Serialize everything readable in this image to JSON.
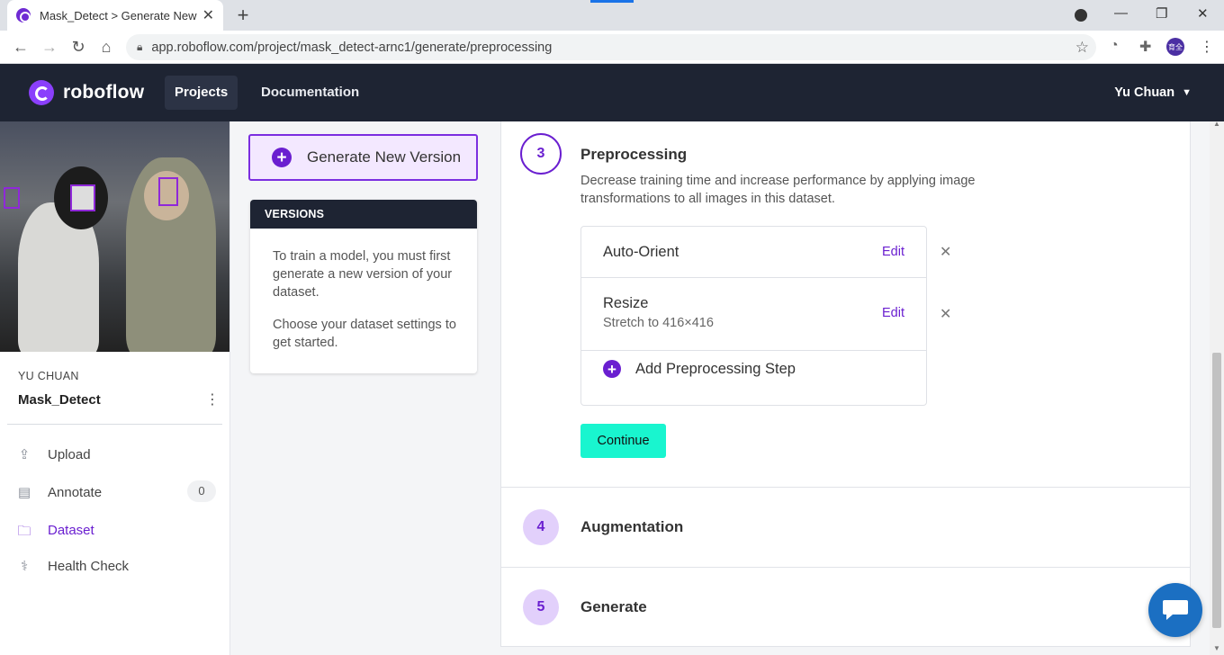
{
  "browser": {
    "tab_title": "Mask_Detect > Generate New V",
    "url": "app.roboflow.com/project/mask_detect-arnc1/generate/preprocessing",
    "profile_initials": "育全"
  },
  "header": {
    "brand": "roboflow",
    "nav": [
      {
        "label": "Projects",
        "active": true
      },
      {
        "label": "Documentation",
        "active": false
      }
    ],
    "user": "Yu Chuan"
  },
  "sidebar": {
    "workspace": "YU CHUAN",
    "project": "Mask_Detect",
    "items": [
      {
        "label": "Upload",
        "icon": "upload-icon"
      },
      {
        "label": "Annotate",
        "icon": "annotate-icon",
        "count": "0"
      },
      {
        "label": "Dataset",
        "icon": "folder-icon",
        "active": true
      },
      {
        "label": "Health Check",
        "icon": "stethoscope-icon"
      }
    ]
  },
  "versions": {
    "generate_label": "Generate New Version",
    "heading": "VERSIONS",
    "p1": "To train a model, you must first generate a new version of your dataset.",
    "p2": "Choose your dataset settings to get started."
  },
  "steps": {
    "preprocessing": {
      "number": "3",
      "title": "Preprocessing",
      "description": "Decrease training time and increase performance by applying image transformations to all images in this dataset.",
      "items": [
        {
          "name": "Auto-Orient",
          "detail": "",
          "edit": "Edit"
        },
        {
          "name": "Resize",
          "detail": "Stretch to 416×416",
          "edit": "Edit"
        }
      ],
      "add_label": "Add Preprocessing Step",
      "continue_label": "Continue"
    },
    "augmentation": {
      "number": "4",
      "title": "Augmentation"
    },
    "generate": {
      "number": "5",
      "title": "Generate"
    }
  },
  "colors": {
    "accent": "#6a1fd0",
    "header_bg": "#1e2433",
    "continue_bg": "#19f5cf",
    "chat_bg": "#1b6fc2"
  }
}
